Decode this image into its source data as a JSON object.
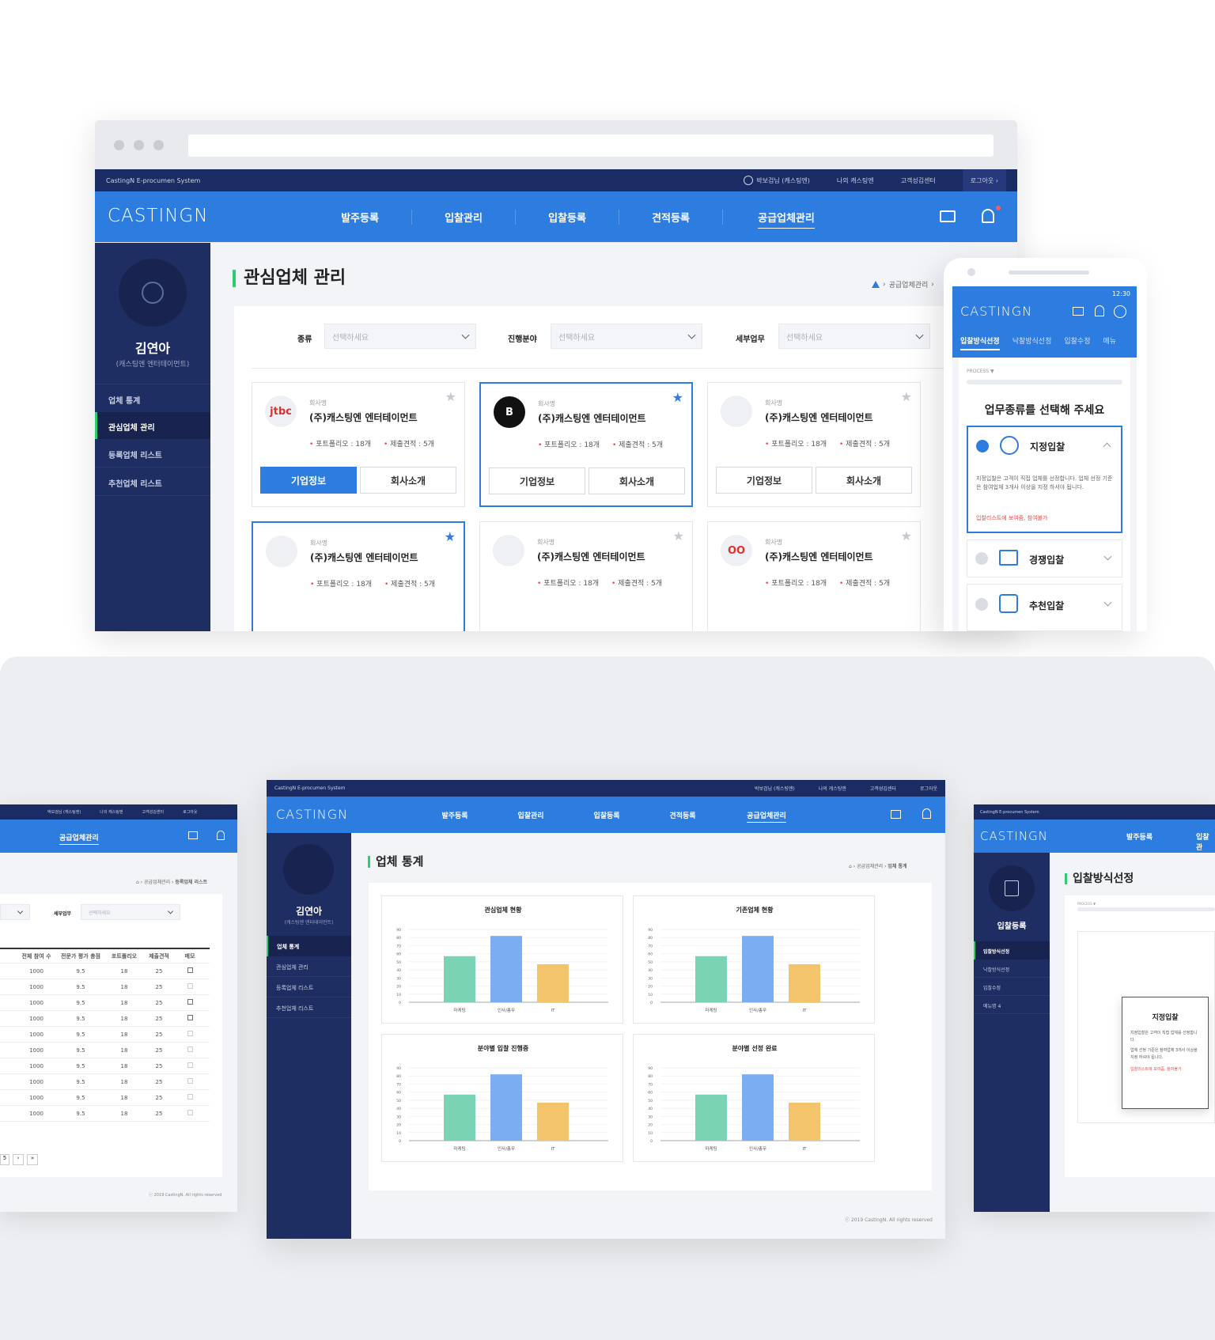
{
  "brand": {
    "logo": "CASTINGN",
    "system_name": "CastingN E-procumen System"
  },
  "topbar": {
    "user": "박보검님 (캐스팅엔)",
    "my": "나의 캐스팅엔",
    "support": "고객성김센터",
    "logout": "로그아웃"
  },
  "nav": {
    "items": [
      "발주등록",
      "입찰관리",
      "입찰등록",
      "견적등록",
      "공급업체관리"
    ],
    "active": "공급업체관리"
  },
  "sidebar": {
    "name": "김연아",
    "company": "(캐스팅엔 엔터테이먼트)",
    "items": [
      "업체 통계",
      "관심업체 관리",
      "등록업체 리스트",
      "추천업체 리스트"
    ],
    "active": "관심업체 관리"
  },
  "main": {
    "title": "관심업체 관리",
    "breadcrumb": "공급업체관리",
    "filters": [
      {
        "label": "종류",
        "placeholder": "선택하세요"
      },
      {
        "label": "진행분야",
        "placeholder": "선택하세요"
      },
      {
        "label": "세부업무",
        "placeholder": "선택하세요"
      }
    ],
    "card_common": {
      "company_label": "회사명",
      "company_name": "(주)캐스팅엔 엔터테이먼트",
      "portfolio": "포트폴리오 : 18개",
      "estimate": "제출견적 : 5개",
      "btn_info": "기업정보",
      "btn_intro": "회사소개"
    },
    "card_logos": [
      "jtbc",
      "B",
      "",
      "",
      "",
      "OO"
    ]
  },
  "mobile": {
    "time": "12:30",
    "tabs": [
      "입찰방식선정",
      "낙찰방식선정",
      "입찰수정",
      "메뉴"
    ],
    "process_label": "PROCESS ▼",
    "title": "업무종류를 선택해 주세요",
    "options": [
      {
        "label": "지정입찰",
        "desc": "지정입찰은 고객이 직접 업체를 선정합니다. 업체 선정 기준은 참여업체 3개사 이상을 지정 하셔야 됩니다.",
        "warn": "입찰리스트에 보여줌, 참여불가"
      },
      {
        "label": "경쟁입찰"
      },
      {
        "label": "추천입찰"
      }
    ]
  },
  "stats": {
    "title": "업체 통계",
    "breadcrumb_mid": "공급업체관리",
    "breadcrumb_end": "업체 통계",
    "footer": "ⓒ 2019 CastingN. All rights reserved"
  },
  "chart_data": [
    {
      "type": "bar",
      "title": "관심업체 현황",
      "categories": [
        "마케팅",
        "인사/총무",
        "IT"
      ],
      "values": [
        57,
        82,
        47
      ],
      "ylim": [
        0,
        90
      ],
      "yticks": [
        0,
        10,
        20,
        30,
        40,
        50,
        60,
        70,
        80,
        90
      ],
      "colors": [
        "#7ad3b2",
        "#7aaef0",
        "#f4c46a"
      ]
    },
    {
      "type": "bar",
      "title": "기존업체 현황",
      "categories": [
        "마케팅",
        "인사/총무",
        "IT"
      ],
      "values": [
        57,
        82,
        47
      ],
      "ylim": [
        0,
        90
      ],
      "yticks": [
        0,
        10,
        20,
        30,
        40,
        50,
        60,
        70,
        80,
        90
      ],
      "colors": [
        "#7ad3b2",
        "#7aaef0",
        "#f4c46a"
      ]
    },
    {
      "type": "bar",
      "title": "분야별 입찰 진행중",
      "categories": [
        "마케팅",
        "인사/총무",
        "IT"
      ],
      "values": [
        57,
        82,
        47
      ],
      "ylim": [
        0,
        90
      ],
      "yticks": [
        0,
        10,
        20,
        30,
        40,
        50,
        60,
        70,
        80,
        90
      ],
      "colors": [
        "#7ad3b2",
        "#7aaef0",
        "#f4c46a"
      ]
    },
    {
      "type": "bar",
      "title": "분야별 선정 완료",
      "categories": [
        "마케팅",
        "인사/총무",
        "IT"
      ],
      "values": [
        57,
        82,
        47
      ],
      "ylim": [
        0,
        90
      ],
      "yticks": [
        0,
        10,
        20,
        30,
        40,
        50,
        60,
        70,
        80,
        90
      ],
      "colors": [
        "#7ad3b2",
        "#7aaef0",
        "#f4c46a"
      ]
    }
  ],
  "left_screen": {
    "nav_item": "공급업체관리",
    "breadcrumb_end": "등록업체 리스트",
    "filter_label": "세부업무",
    "filter_placeholder": "선택하세요",
    "columns": [
      "전체 참여 수",
      "전문가 평가 총점",
      "포트폴리오",
      "제출견적",
      "메모"
    ],
    "rows": [
      [
        "1000",
        "9.5",
        "18",
        "25"
      ],
      [
        "1000",
        "9.5",
        "18",
        "25"
      ],
      [
        "1000",
        "9.5",
        "18",
        "25"
      ],
      [
        "1000",
        "9.5",
        "18",
        "25"
      ],
      [
        "1000",
        "9.5",
        "18",
        "25"
      ],
      [
        "1000",
        "9.5",
        "18",
        "25"
      ],
      [
        "1000",
        "9.5",
        "18",
        "25"
      ],
      [
        "1000",
        "9.5",
        "18",
        "25"
      ],
      [
        "1000",
        "9.5",
        "18",
        "25"
      ],
      [
        "1000",
        "9.5",
        "18",
        "25"
      ]
    ],
    "pager": [
      "5",
      "›",
      "»"
    ],
    "footer": "ⓒ 2019 CastingN. All rights reserved"
  },
  "right_screen": {
    "nav_items": [
      "발주등록",
      "입찰관"
    ],
    "side_title": "입찰등록",
    "side_items": [
      "입찰방식선정",
      "낙찰방식선정",
      "입찰수정",
      "메뉴명 4"
    ],
    "page_title": "입찰방식선정",
    "process_label": "PROCESS ▼",
    "popup_title": "지정입찰",
    "popup_text1": "지정입찰은 고객이 직접 업체를 선정합니다.",
    "popup_text2": "업체 선정 기준은 참여업체 3개사 이상을 지정 하셔야 됩니다.",
    "popup_warn": "입찰리스트에 보여줌, 참여불가"
  }
}
